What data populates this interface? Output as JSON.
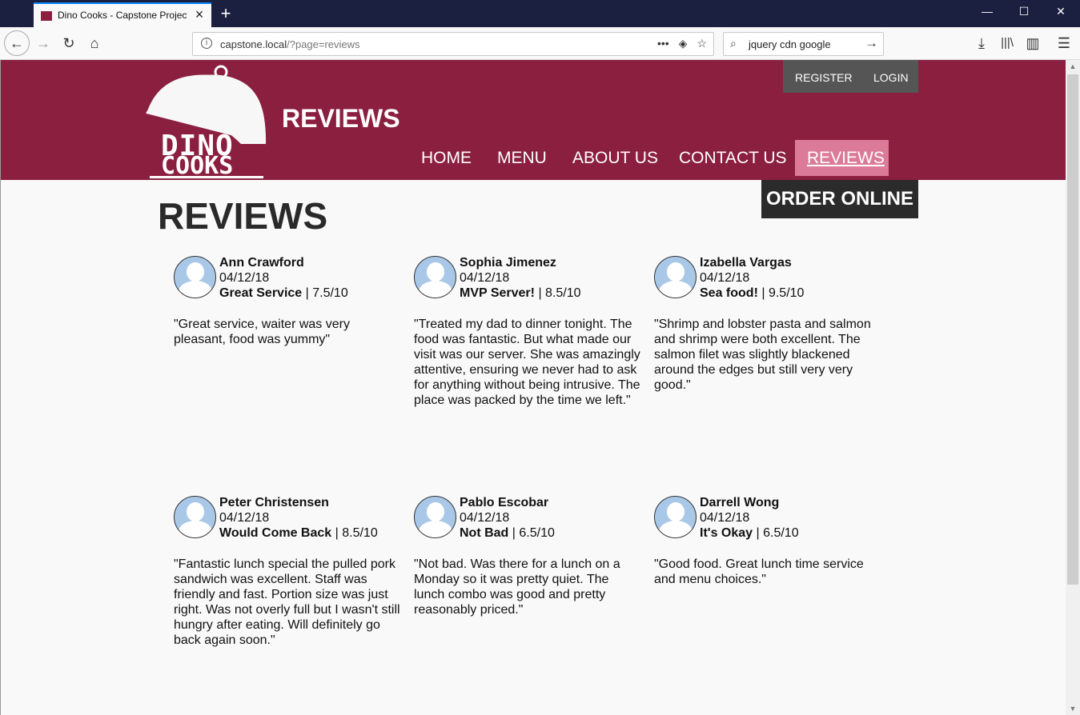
{
  "browser": {
    "tab_title": "Dino Cooks - Capstone Project",
    "url_host": "capstone.local",
    "url_path": "/?page=reviews",
    "search_text": "jquery cdn google"
  },
  "site": {
    "logo_line1": "DINO",
    "logo_line2": "COOKS",
    "page_heading": "REVIEWS",
    "register": "REGISTER",
    "login": "LOGIN",
    "nav": [
      "HOME",
      "MENU",
      "ABOUT US",
      "CONTACT US",
      "REVIEWS"
    ],
    "order_online": "ORDER ONLINE",
    "h1": "REVIEWS"
  },
  "reviews": [
    {
      "name": "Ann Crawford",
      "date": "04/12/18",
      "title": "Great Service",
      "score": "| 7.5/10",
      "text": "\"Great service, waiter was very pleasant, food was yummy\""
    },
    {
      "name": "Sophia Jimenez",
      "date": "04/12/18",
      "title": "MVP Server!",
      "score": "| 8.5/10",
      "text": "\"Treated my dad to dinner tonight. The food was fantastic. But what made our visit was our server. She was amazingly attentive, ensuring we never had to ask for anything without being intrusive. The place was packed by the time we left.\""
    },
    {
      "name": "Izabella Vargas",
      "date": "04/12/18",
      "title": "Sea food!",
      "score": "| 9.5/10",
      "text": "\"Shrimp and lobster pasta and salmon and shrimp were both excellent. The salmon filet was slightly blackened around the edges but still very very good.\""
    },
    {
      "name": "Peter Christensen",
      "date": "04/12/18",
      "title": "Would Come Back",
      "score": "| 8.5/10",
      "text": "\"Fantastic lunch special the pulled pork sandwich was excellent. Staff was friendly and fast. Portion size was just right. Was not overly full but I wasn't still hungry after eating. Will definitely go back again soon.\""
    },
    {
      "name": "Pablo Escobar",
      "date": "04/12/18",
      "title": "Not Bad",
      "score": "| 6.5/10",
      "text": "\"Not bad. Was there for a lunch on a Monday so it was pretty quiet. The lunch combo was good and pretty reasonably priced.\""
    },
    {
      "name": "Darrell Wong",
      "date": "04/12/18",
      "title": "It's Okay",
      "score": "| 6.5/10",
      "text": "\"Good food. Great lunch time service and menu choices.\""
    }
  ],
  "colors": {
    "header": "#8b1f3f",
    "active_nav": "#db7a99",
    "order_bg": "#2b2b2b"
  }
}
